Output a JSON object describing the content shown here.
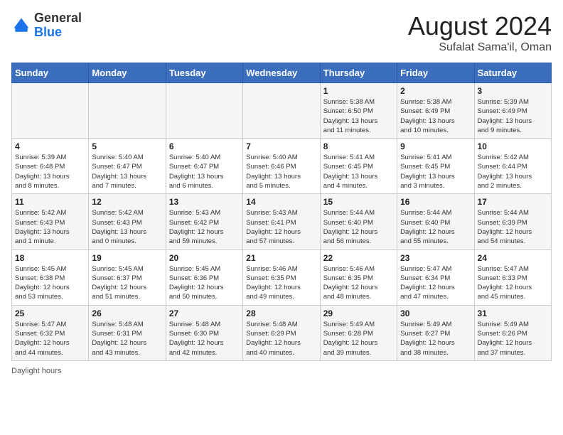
{
  "header": {
    "logo": {
      "general": "General",
      "blue": "Blue"
    },
    "title": "August 2024",
    "subtitle": "Sufalat Sama'il, Oman"
  },
  "days_of_week": [
    "Sunday",
    "Monday",
    "Tuesday",
    "Wednesday",
    "Thursday",
    "Friday",
    "Saturday"
  ],
  "weeks": [
    [
      {
        "day": "",
        "info": ""
      },
      {
        "day": "",
        "info": ""
      },
      {
        "day": "",
        "info": ""
      },
      {
        "day": "",
        "info": ""
      },
      {
        "day": "1",
        "info": "Sunrise: 5:38 AM\nSunset: 6:50 PM\nDaylight: 13 hours\nand 11 minutes."
      },
      {
        "day": "2",
        "info": "Sunrise: 5:38 AM\nSunset: 6:49 PM\nDaylight: 13 hours\nand 10 minutes."
      },
      {
        "day": "3",
        "info": "Sunrise: 5:39 AM\nSunset: 6:49 PM\nDaylight: 13 hours\nand 9 minutes."
      }
    ],
    [
      {
        "day": "4",
        "info": "Sunrise: 5:39 AM\nSunset: 6:48 PM\nDaylight: 13 hours\nand 8 minutes."
      },
      {
        "day": "5",
        "info": "Sunrise: 5:40 AM\nSunset: 6:47 PM\nDaylight: 13 hours\nand 7 minutes."
      },
      {
        "day": "6",
        "info": "Sunrise: 5:40 AM\nSunset: 6:47 PM\nDaylight: 13 hours\nand 6 minutes."
      },
      {
        "day": "7",
        "info": "Sunrise: 5:40 AM\nSunset: 6:46 PM\nDaylight: 13 hours\nand 5 minutes."
      },
      {
        "day": "8",
        "info": "Sunrise: 5:41 AM\nSunset: 6:45 PM\nDaylight: 13 hours\nand 4 minutes."
      },
      {
        "day": "9",
        "info": "Sunrise: 5:41 AM\nSunset: 6:45 PM\nDaylight: 13 hours\nand 3 minutes."
      },
      {
        "day": "10",
        "info": "Sunrise: 5:42 AM\nSunset: 6:44 PM\nDaylight: 13 hours\nand 2 minutes."
      }
    ],
    [
      {
        "day": "11",
        "info": "Sunrise: 5:42 AM\nSunset: 6:43 PM\nDaylight: 13 hours\nand 1 minute."
      },
      {
        "day": "12",
        "info": "Sunrise: 5:42 AM\nSunset: 6:43 PM\nDaylight: 13 hours\nand 0 minutes."
      },
      {
        "day": "13",
        "info": "Sunrise: 5:43 AM\nSunset: 6:42 PM\nDaylight: 12 hours\nand 59 minutes."
      },
      {
        "day": "14",
        "info": "Sunrise: 5:43 AM\nSunset: 6:41 PM\nDaylight: 12 hours\nand 57 minutes."
      },
      {
        "day": "15",
        "info": "Sunrise: 5:44 AM\nSunset: 6:40 PM\nDaylight: 12 hours\nand 56 minutes."
      },
      {
        "day": "16",
        "info": "Sunrise: 5:44 AM\nSunset: 6:40 PM\nDaylight: 12 hours\nand 55 minutes."
      },
      {
        "day": "17",
        "info": "Sunrise: 5:44 AM\nSunset: 6:39 PM\nDaylight: 12 hours\nand 54 minutes."
      }
    ],
    [
      {
        "day": "18",
        "info": "Sunrise: 5:45 AM\nSunset: 6:38 PM\nDaylight: 12 hours\nand 53 minutes."
      },
      {
        "day": "19",
        "info": "Sunrise: 5:45 AM\nSunset: 6:37 PM\nDaylight: 12 hours\nand 51 minutes."
      },
      {
        "day": "20",
        "info": "Sunrise: 5:45 AM\nSunset: 6:36 PM\nDaylight: 12 hours\nand 50 minutes."
      },
      {
        "day": "21",
        "info": "Sunrise: 5:46 AM\nSunset: 6:35 PM\nDaylight: 12 hours\nand 49 minutes."
      },
      {
        "day": "22",
        "info": "Sunrise: 5:46 AM\nSunset: 6:35 PM\nDaylight: 12 hours\nand 48 minutes."
      },
      {
        "day": "23",
        "info": "Sunrise: 5:47 AM\nSunset: 6:34 PM\nDaylight: 12 hours\nand 47 minutes."
      },
      {
        "day": "24",
        "info": "Sunrise: 5:47 AM\nSunset: 6:33 PM\nDaylight: 12 hours\nand 45 minutes."
      }
    ],
    [
      {
        "day": "25",
        "info": "Sunrise: 5:47 AM\nSunset: 6:32 PM\nDaylight: 12 hours\nand 44 minutes."
      },
      {
        "day": "26",
        "info": "Sunrise: 5:48 AM\nSunset: 6:31 PM\nDaylight: 12 hours\nand 43 minutes."
      },
      {
        "day": "27",
        "info": "Sunrise: 5:48 AM\nSunset: 6:30 PM\nDaylight: 12 hours\nand 42 minutes."
      },
      {
        "day": "28",
        "info": "Sunrise: 5:48 AM\nSunset: 6:29 PM\nDaylight: 12 hours\nand 40 minutes."
      },
      {
        "day": "29",
        "info": "Sunrise: 5:49 AM\nSunset: 6:28 PM\nDaylight: 12 hours\nand 39 minutes."
      },
      {
        "day": "30",
        "info": "Sunrise: 5:49 AM\nSunset: 6:27 PM\nDaylight: 12 hours\nand 38 minutes."
      },
      {
        "day": "31",
        "info": "Sunrise: 5:49 AM\nSunset: 6:26 PM\nDaylight: 12 hours\nand 37 minutes."
      }
    ]
  ],
  "footer": {
    "daylight_label": "Daylight hours"
  }
}
